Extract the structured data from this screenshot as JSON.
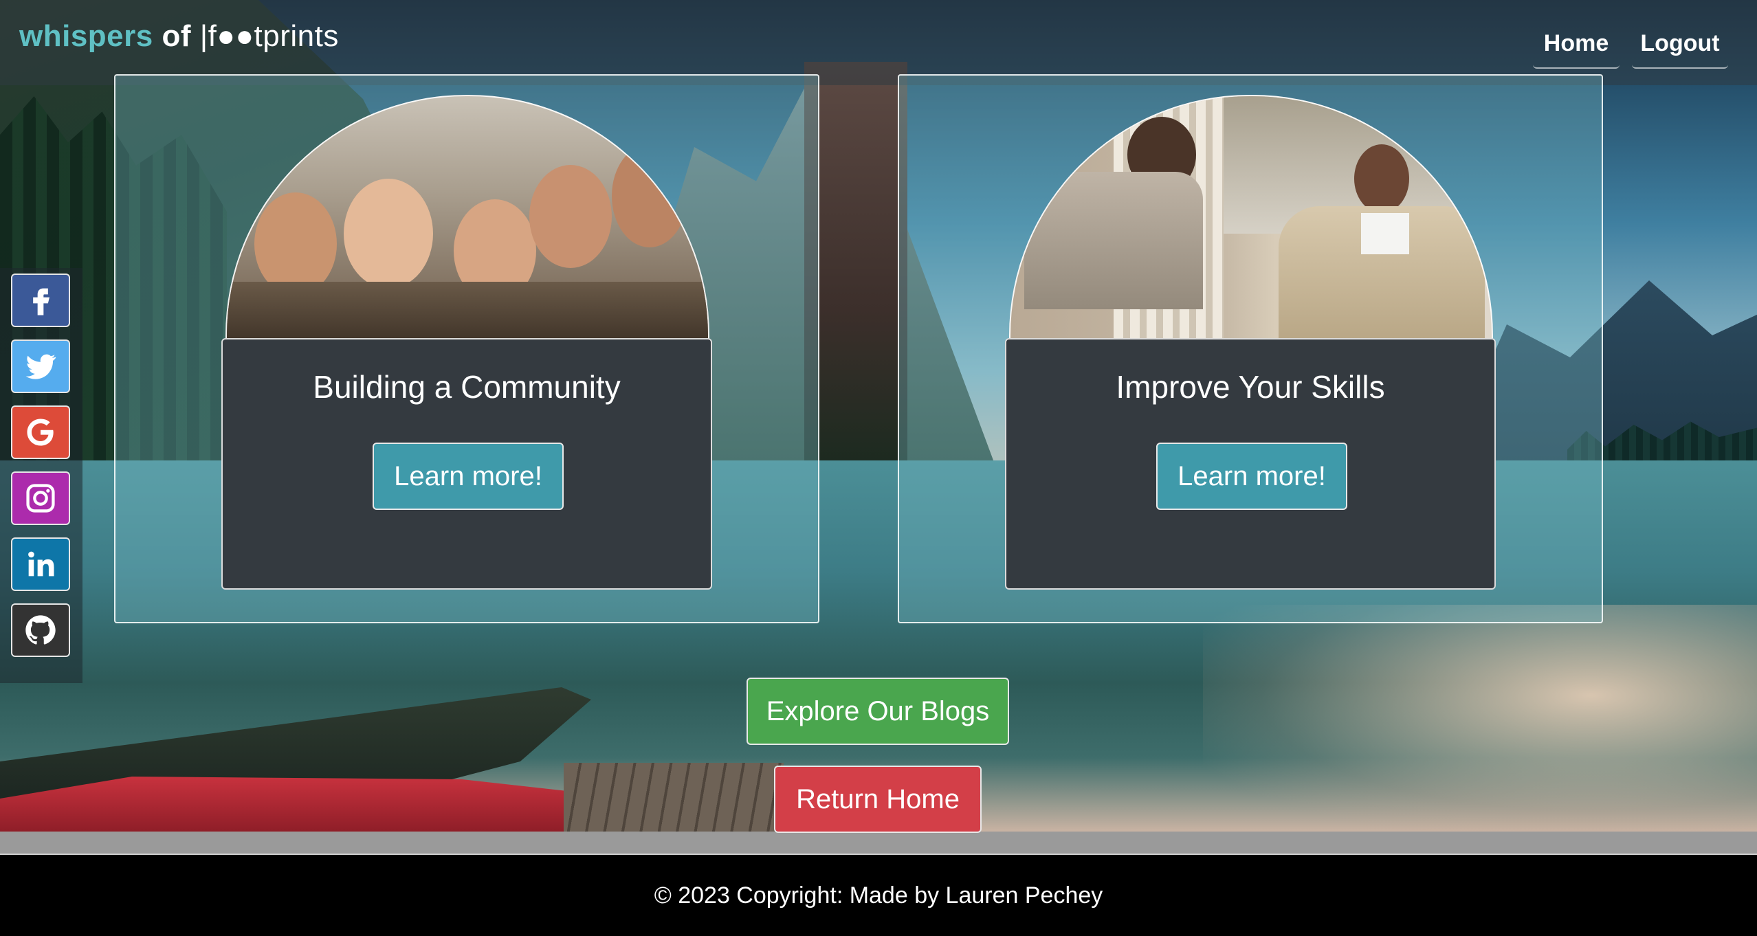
{
  "brand": {
    "part1": "whispers",
    "part2": " of ",
    "part3": "|f●●tprints"
  },
  "nav": {
    "home": "Home",
    "logout": "Logout"
  },
  "social": [
    "facebook",
    "twitter",
    "google",
    "instagram",
    "linkedin",
    "github"
  ],
  "features": [
    {
      "title": "Building a Community",
      "button": "Learn more!"
    },
    {
      "title": "Improve Your Skills",
      "button": "Learn more!"
    }
  ],
  "actions": {
    "explore": "Explore Our Blogs",
    "return": "Return Home"
  },
  "footer": {
    "text": "© 2023 Copyright: Made by Lauren Pechey"
  },
  "colors": {
    "brand_accent": "#5fc0c4",
    "learn_btn": "#3f9aaa",
    "explore_btn": "#4aa64e",
    "return_btn": "#d33f48",
    "card": "#343a40"
  }
}
